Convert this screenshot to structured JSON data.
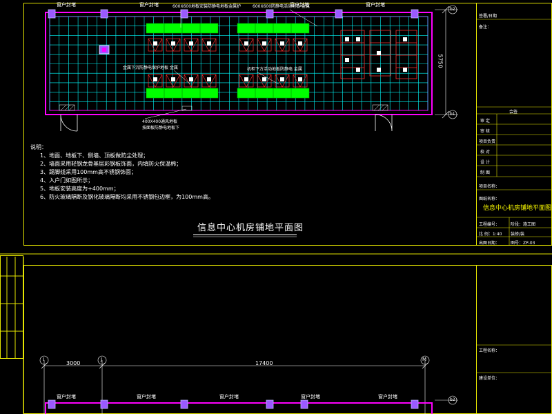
{
  "labels": {
    "window_top_1": "窗户封堵",
    "window_top_2": "窗户封堵",
    "window_top_3": "窗户封堵",
    "window_top_4": "窗户封堵",
    "window_bottom_1": "窗户封堵",
    "window_bottom_2": "窗户封堵",
    "window_bottom_3": "窗户封堵",
    "window_bottom_4": "窗户封堵",
    "window_bottom_5": "窗户封堵",
    "callout_top_left": "600X600地板安装防静电地板金属护",
    "callout_top_right": "600X600防静电活动地板 金属",
    "callout_mid_left": "金属下沉防静电保护地板 金属",
    "callout_mid_right": "机柜下方活动地板防静电 金属",
    "callout_bottom": "400X400通风地板\n按面板防静电地板下",
    "dim_vertical": "5750",
    "axis_top_right_1": "b2",
    "axis_top_right_2": "b1",
    "axis_bottom_left": "I",
    "axis_bottom_mid": "J",
    "axis_bottom_right": "M",
    "dim_bottom_1": "3000",
    "dim_bottom_2": "17400",
    "axis_bottom_row": "b2"
  },
  "notes": {
    "heading": "说明：",
    "lines": [
      "1、地面、地板下、侧墙、顶板做防尘处理；",
      "2、墙面采用轻钢龙骨基层彩钢板饰面，内填防火保温棉；",
      "3、踢脚线采用100mm高不锈钢饰面；",
      "4、入户门如图所示；",
      "5、地板安装高度为+400mm；",
      "6、防火玻璃隔断及钢化玻璃隔断均采用不锈钢包边框，为100mm高。"
    ]
  },
  "drawing_title": "信息中心机房铺地平面图",
  "title_block": {
    "row1": "签署/日期",
    "row2": "备注：",
    "seal": "会签",
    "rows": [
      "审 定",
      "审 核",
      "项目负责",
      "校 对",
      "设 计",
      "制 图"
    ],
    "project_label": "项目名称：",
    "drawing_label": "图纸名称：",
    "drawing_name": "信息中心机房铺地平面图",
    "stage_label": "工程编号：",
    "stage_value": "阶段：施工图",
    "scale_label": "比 例：1:40",
    "sheet_label": "专 业：",
    "sheet_value": "装修/装",
    "date_label": "出图日期：",
    "drawing_no": "图号：ZP-03",
    "lower_row1": "工程名称：",
    "lower_row2": "建设单位："
  },
  "colors": {
    "frame": "#e6e600",
    "grid": "#00ffff",
    "wall": "#ff00ff",
    "green": "#00ff00",
    "red": "#ff0000",
    "blue": "#6a6aff",
    "purple": "#9a5aff",
    "white": "#ffffff"
  }
}
